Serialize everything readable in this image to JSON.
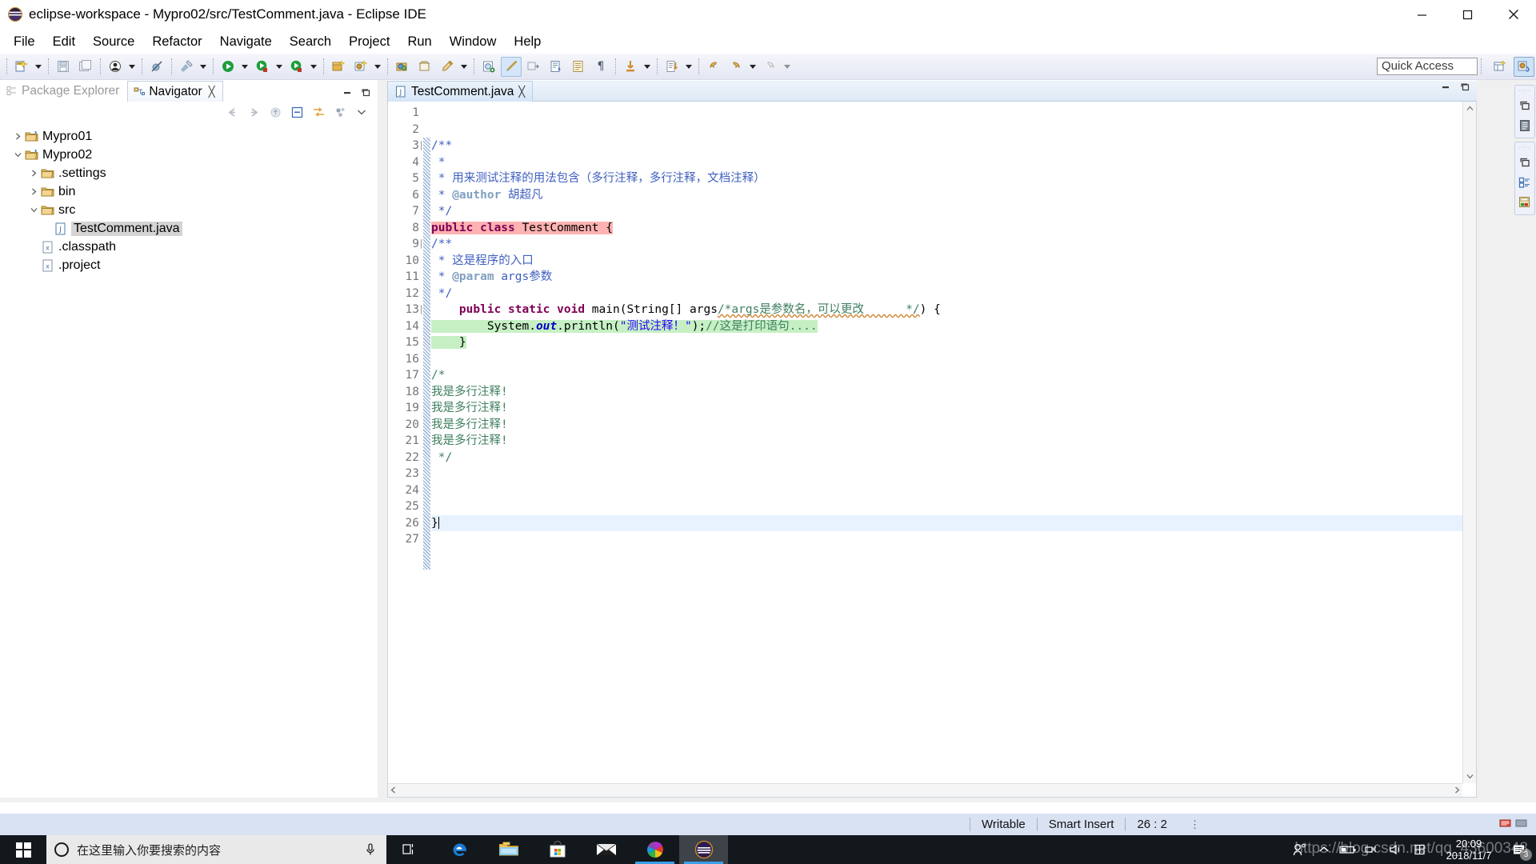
{
  "window": {
    "title": "eclipse-workspace - Mypro02/src/TestComment.java - Eclipse IDE",
    "minimize": "—",
    "maximize": "❐",
    "close": "✕"
  },
  "menubar": {
    "items": [
      "File",
      "Edit",
      "Source",
      "Refactor",
      "Navigate",
      "Search",
      "Project",
      "Run",
      "Window",
      "Help"
    ]
  },
  "toolbar": {
    "quick_access_placeholder": "Quick Access",
    "buttons": [
      "new-wizard",
      "save",
      "save-all",
      "print-preview",
      "debug-skip-breakpoints",
      "external-tools",
      "run",
      "debug",
      "coverage",
      "new-java-project",
      "new-java-package",
      "new-class",
      "open-type",
      "search",
      "annotation",
      "last-edit-location",
      "back",
      "forward",
      "next-annotation"
    ],
    "perspective_buttons": [
      "open-perspective",
      "java-perspective"
    ]
  },
  "left_view": {
    "tabs": [
      {
        "label": "Package Explorer",
        "active": false,
        "closable": false
      },
      {
        "label": "Navigator",
        "active": true,
        "closable": true
      }
    ],
    "close_glyph": "╳",
    "minimize_glyph": "—",
    "maximize_glyph": "❐",
    "toolbar_icons": [
      "back-arrow",
      "forward-arrow",
      "up-arrow",
      "collapse-all",
      "link-with-editor",
      "view-menu-extra",
      "view-menu"
    ],
    "tree": [
      {
        "label": "Mypro01",
        "indent": 0,
        "twisty": "collapsed",
        "icon": "project-folder",
        "selected": false
      },
      {
        "label": "Mypro02",
        "indent": 0,
        "twisty": "expanded",
        "icon": "project-folder",
        "selected": false
      },
      {
        "label": ".settings",
        "indent": 1,
        "twisty": "collapsed",
        "icon": "folder",
        "selected": false
      },
      {
        "label": "bin",
        "indent": 1,
        "twisty": "collapsed",
        "icon": "folder",
        "selected": false
      },
      {
        "label": "src",
        "indent": 1,
        "twisty": "expanded",
        "icon": "folder",
        "selected": false
      },
      {
        "label": "TestComment.java",
        "indent": 2,
        "twisty": "none",
        "icon": "java-file",
        "selected": true
      },
      {
        "label": ".classpath",
        "indent": 1,
        "twisty": "none",
        "icon": "xml-file",
        "selected": false
      },
      {
        "label": ".project",
        "indent": 1,
        "twisty": "none",
        "icon": "xml-file",
        "selected": false
      }
    ]
  },
  "editor": {
    "tab_label": "TestComment.java",
    "tab_close_glyph": "╳",
    "minimize_glyph": "—",
    "maximize_glyph": "❐",
    "cursor_line": 26,
    "lines": [
      {
        "n": 1,
        "fold": null,
        "text": ""
      },
      {
        "n": 2,
        "fold": null,
        "text": ""
      },
      {
        "n": 3,
        "fold": "⊖",
        "text": "/**"
      },
      {
        "n": 4,
        "fold": null,
        "text": " *"
      },
      {
        "n": 5,
        "fold": null,
        "text": " * 用来测试注释的用法包含（多行注释，多行注释，文档注释）"
      },
      {
        "n": 6,
        "fold": null,
        "text": " * @author 胡超凡"
      },
      {
        "n": 7,
        "fold": null,
        "text": " */"
      },
      {
        "n": 8,
        "fold": null,
        "text": "public class TestComment {"
      },
      {
        "n": 9,
        "fold": "⊖",
        "text": "/**"
      },
      {
        "n": 10,
        "fold": null,
        "text": " * 这是程序的入口"
      },
      {
        "n": 11,
        "fold": null,
        "text": " * @param args参数"
      },
      {
        "n": 12,
        "fold": null,
        "text": " */"
      },
      {
        "n": 13,
        "fold": "⊖",
        "text": "    public static void main(String[] args/*args是参数名，可以更改      */) {"
      },
      {
        "n": 14,
        "fold": null,
        "text": "        System.out.println(\"测试注释！\");//这是打印语句...."
      },
      {
        "n": 15,
        "fold": null,
        "text": "    }"
      },
      {
        "n": 16,
        "fold": null,
        "text": ""
      },
      {
        "n": 17,
        "fold": null,
        "text": "/*"
      },
      {
        "n": 18,
        "fold": null,
        "text": "我是多行注释!"
      },
      {
        "n": 19,
        "fold": null,
        "text": "我是多行注释!"
      },
      {
        "n": 20,
        "fold": null,
        "text": "我是多行注释!"
      },
      {
        "n": 21,
        "fold": null,
        "text": "我是多行注释!"
      },
      {
        "n": 22,
        "fold": null,
        "text": " */"
      },
      {
        "n": 23,
        "fold": null,
        "text": ""
      },
      {
        "n": 24,
        "fold": null,
        "text": ""
      },
      {
        "n": 25,
        "fold": null,
        "text": ""
      },
      {
        "n": 26,
        "fold": null,
        "text": "}"
      },
      {
        "n": 27,
        "fold": null,
        "text": ""
      }
    ],
    "code_tokens": {
      "l8": {
        "kw1": "public class",
        "name": " TestComment ",
        "brace": "{"
      },
      "l13": {
        "kw": "public static void",
        "sig": " main(String[] args",
        "comment": "/*args是参数名，可以更改      */",
        "tail": ") {"
      },
      "l14": {
        "pre": "        System.",
        "field": "out",
        "mid": ".println(",
        "str": "\"测试注释！\"",
        "post": ");",
        "comment": "//这是打印语句...."
      }
    },
    "highlight_colors": {
      "error": "#ffb2b2",
      "search": "#c6f0c4",
      "current_line": "#e8f2fe"
    }
  },
  "right_bar": {
    "groups": [
      {
        "dots": "····",
        "icons": [
          "restore-view",
          "outline-view"
        ]
      },
      {
        "dots": "····",
        "icons": [
          "restore-view",
          "task-list",
          "properties-view"
        ]
      }
    ]
  },
  "statusbar": {
    "writable": "Writable",
    "insert_mode": "Smart Insert",
    "position": "26 : 2",
    "dots": "⋮"
  },
  "taskbar": {
    "search_placeholder": "在这里输入你要搜索的内容",
    "apps": [
      {
        "name": "task-view",
        "running": false,
        "focused": false
      },
      {
        "name": "microsoft-edge",
        "running": false,
        "focused": false
      },
      {
        "name": "file-explorer",
        "running": false,
        "focused": false
      },
      {
        "name": "microsoft-store",
        "running": false,
        "focused": false
      },
      {
        "name": "mail",
        "running": false,
        "focused": false
      },
      {
        "name": "photos",
        "running": true,
        "focused": false
      },
      {
        "name": "eclipse",
        "running": true,
        "focused": true
      }
    ],
    "tray_icons": [
      "people",
      "show-hidden-icons",
      "battery",
      "network",
      "volume",
      "ime"
    ],
    "clock_time": "20:09",
    "clock_date": "2018/11/7",
    "notification_count": "3",
    "watermark": "https://blog.csdn.net/qq_43600348"
  }
}
